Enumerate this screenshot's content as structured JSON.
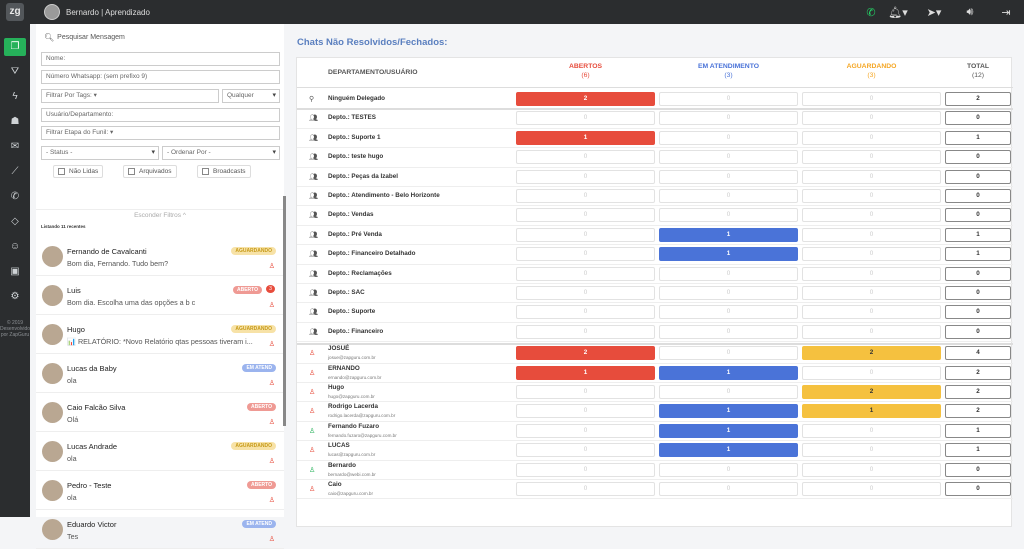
{
  "topbar": {
    "logo": "zg",
    "user": "Bernardo | Aprendizado"
  },
  "sidebar": {
    "footer": [
      "© 2019",
      "Desenvolvido",
      "por ZapGuru"
    ]
  },
  "filters": {
    "search": "Pesquisar Mensagem",
    "name": "Nome:",
    "whatsapp": "Número Whatsapp: (sem prefixo 9)",
    "tags": "Filtrar Por Tags:",
    "tags_mode": "Qualquer",
    "user_dept": "Usuário/Departamento:",
    "funnel": "Filtrar Etapa do Funil:",
    "status": "- Status -",
    "order": "- Ordenar Por -",
    "unread": "Não Lidas",
    "archived": "Arquivados",
    "broadcasts": "Broadcasts",
    "hide": "Esconder Filtros ^"
  },
  "listing": "Listando 11 recentes",
  "chats": [
    {
      "name": "Fernando de Cavalcanti",
      "msg": "Bom dia, Fernando. Tudo bem?",
      "badge": "AGUARDANDO",
      "kind": "ag",
      "count": ""
    },
    {
      "name": "Luis",
      "msg": "Bom dia. Escolha uma das opções a b c",
      "badge": "ABERTO",
      "kind": "ab",
      "count": "3"
    },
    {
      "name": "Hugo",
      "msg": "📊 RELATÓRIO: *Novo Relatório qtas pessoas tiveram i...",
      "badge": "AGUARDANDO",
      "kind": "ag",
      "count": ""
    },
    {
      "name": "Lucas da Baby",
      "msg": "ola",
      "badge": "EM ATEND",
      "kind": "em",
      "count": ""
    },
    {
      "name": "Caio Falcão Silva",
      "msg": "Olá",
      "badge": "ABERTO",
      "kind": "ab",
      "count": ""
    },
    {
      "name": "Lucas Andrade",
      "msg": "ola",
      "badge": "AGUARDANDO",
      "kind": "ag",
      "count": ""
    },
    {
      "name": "Pedro - Teste",
      "msg": "ola",
      "badge": "ABERTO",
      "kind": "ab",
      "count": ""
    },
    {
      "name": "Eduardo Victor",
      "msg": "Tes",
      "badge": "EM ATEND",
      "kind": "em",
      "count": ""
    }
  ],
  "main": {
    "title": "Chats Não Resolvidos/Fechados:",
    "headers": {
      "dept": "DEPARTAMENTO/USUÁRIO",
      "open": "ABERTOS",
      "open_n": "(6)",
      "attending": "EM ATENDIMENTO",
      "attending_n": "(3)",
      "waiting": "AGUARDANDO",
      "waiting_n": "(3)",
      "total": "TOTAL",
      "total_n": "(12)"
    },
    "colors": {
      "open": "#e74c3c",
      "attending": "#4a73d8",
      "waiting": "#f5a623"
    },
    "rows": [
      {
        "label": "Ninguém Delegado",
        "email": "",
        "type": "none",
        "open": "2",
        "att": "0",
        "wait": "0",
        "total": "2"
      },
      {
        "label": "Depto.: TESTES",
        "email": "",
        "type": "dept",
        "open": "0",
        "att": "0",
        "wait": "0",
        "total": "0"
      },
      {
        "label": "Depto.: Suporte 1",
        "email": "",
        "type": "dept",
        "open": "1",
        "att": "0",
        "wait": "0",
        "total": "1"
      },
      {
        "label": "Depto.: teste hugo",
        "email": "",
        "type": "dept",
        "open": "0",
        "att": "0",
        "wait": "0",
        "total": "0"
      },
      {
        "label": "Depto.: Peças da Izabel",
        "email": "",
        "type": "dept",
        "open": "0",
        "att": "0",
        "wait": "0",
        "total": "0"
      },
      {
        "label": "Depto.: Atendimento - Belo Horizonte",
        "email": "",
        "type": "dept",
        "open": "0",
        "att": "0",
        "wait": "0",
        "total": "0"
      },
      {
        "label": "Depto.: Vendas",
        "email": "",
        "type": "dept",
        "open": "0",
        "att": "0",
        "wait": "0",
        "total": "0"
      },
      {
        "label": "Depto.: Pré Venda",
        "email": "",
        "type": "dept",
        "open": "0",
        "att": "1",
        "wait": "0",
        "total": "1"
      },
      {
        "label": "Depto.: Financeiro Detalhado",
        "email": "",
        "type": "dept",
        "open": "0",
        "att": "1",
        "wait": "0",
        "total": "1"
      },
      {
        "label": "Depto.: Reclamações",
        "email": "",
        "type": "dept",
        "open": "0",
        "att": "0",
        "wait": "0",
        "total": "0"
      },
      {
        "label": "Depto.: SAC",
        "email": "",
        "type": "dept",
        "open": "0",
        "att": "0",
        "wait": "0",
        "total": "0"
      },
      {
        "label": "Depto.: Suporte",
        "email": "",
        "type": "dept",
        "open": "0",
        "att": "0",
        "wait": "0",
        "total": "0"
      },
      {
        "label": "Depto.: Financeiro",
        "email": "",
        "type": "dept",
        "open": "0",
        "att": "0",
        "wait": "0",
        "total": "0"
      },
      {
        "label": "JOSUÉ",
        "email": "josue@zapguru.com.br",
        "type": "user",
        "open": "2",
        "att": "0",
        "wait": "2",
        "total": "4"
      },
      {
        "label": "ERNANDO",
        "email": "ernando@zapguru.com.br",
        "type": "user",
        "open": "1",
        "att": "1",
        "wait": "0",
        "total": "2"
      },
      {
        "label": "Hugo",
        "email": "hugo@zapguru.com.br",
        "type": "user",
        "open": "0",
        "att": "0",
        "wait": "2",
        "total": "2"
      },
      {
        "label": "Rodrigo Lacerda",
        "email": "rodrigo.lacerda@zapguru.com.br",
        "type": "user",
        "open": "0",
        "att": "1",
        "wait": "1",
        "total": "2"
      },
      {
        "label": "Fernando Fuzaro",
        "email": "fernando.fuzaro@zapguru.com.br",
        "type": "user-g",
        "open": "0",
        "att": "1",
        "wait": "0",
        "total": "1"
      },
      {
        "label": "LUCAS",
        "email": "lucas@zapguru.com.br",
        "type": "user",
        "open": "0",
        "att": "1",
        "wait": "0",
        "total": "1"
      },
      {
        "label": "Bernardo",
        "email": "bernardo@webi.com.br",
        "type": "user-g",
        "open": "0",
        "att": "0",
        "wait": "0",
        "total": "0"
      },
      {
        "label": "Caio",
        "email": "caio@zapguru.com.br",
        "type": "user",
        "open": "0",
        "att": "0",
        "wait": "0",
        "total": "0"
      }
    ]
  }
}
